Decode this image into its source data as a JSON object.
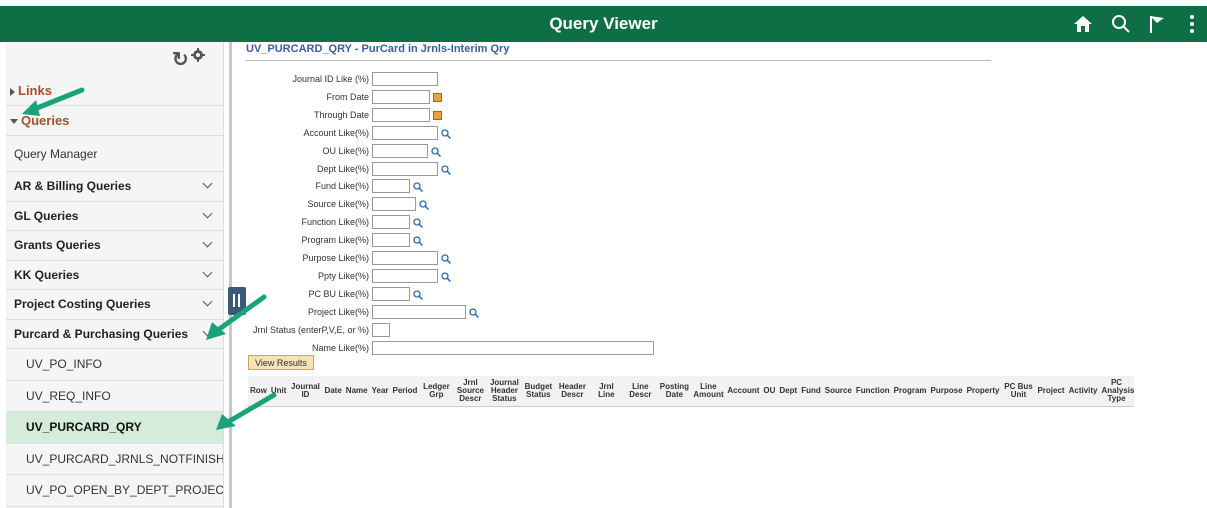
{
  "header": {
    "title": "Query Viewer"
  },
  "header_icons": [
    "home-icon",
    "search-icon",
    "flag-icon",
    "more-vert-icon"
  ],
  "sidebar": {
    "links_label": "Links",
    "queries_label": "Queries",
    "query_manager": "Query Manager",
    "groups": [
      "AR & Billing Queries",
      "GL Queries",
      "Grants Queries",
      "KK Queries",
      "Project Costing Queries",
      "Purcard & Purchasing Queries"
    ],
    "items": [
      "UV_PO_INFO",
      "UV_REQ_INFO",
      "UV_PURCARD_QRY",
      "UV_PURCARD_JRNLS_NOTFINISHED",
      "UV_PO_OPEN_BY_DEPT_PROJECT"
    ],
    "selected_item": "UV_PURCARD_QRY"
  },
  "query": {
    "title": "UV_PURCARD_QRY - PurCard in Jrnls-Interim Qry",
    "prompts": [
      {
        "label": "Journal ID Like (%)",
        "value": ""
      },
      {
        "label": "From Date",
        "value": ""
      },
      {
        "label": "Through Date",
        "value": ""
      },
      {
        "label": "Account Like(%)",
        "value": ""
      },
      {
        "label": "OU Like(%)",
        "value": ""
      },
      {
        "label": "Dept Like(%)",
        "value": ""
      },
      {
        "label": "Fund Like(%)",
        "value": ""
      },
      {
        "label": "Source Like(%)",
        "value": ""
      },
      {
        "label": "Function Like(%)",
        "value": ""
      },
      {
        "label": "Program Like(%)",
        "value": ""
      },
      {
        "label": "Purpose Like(%)",
        "value": ""
      },
      {
        "label": "Ppty Like(%)",
        "value": ""
      },
      {
        "label": "PC BU Like(%)",
        "value": ""
      },
      {
        "label": "Project Like(%)",
        "value": ""
      },
      {
        "label": "Jrnl Status (enterP,V,E, or %)",
        "value": ""
      },
      {
        "label": "Name Like(%)",
        "value": ""
      }
    ],
    "view_results": "View Results",
    "columns": [
      "Row",
      "Unit",
      "Journal ID",
      "Date",
      "Name",
      "Year",
      "Period",
      "Ledger Grp",
      "Jrnl Source Descr",
      "Journal Header Status",
      "Budget Status",
      "Header Descr",
      "Jrnl Line",
      "Line Descr",
      "Posting Date",
      "Line Amount",
      "Account",
      "OU",
      "Dept",
      "Fund",
      "Source",
      "Function",
      "Program",
      "Purpose",
      "Property",
      "PC Bus Unit",
      "Project",
      "Activity",
      "PC Analysis Type"
    ]
  },
  "colors": {
    "header_bg": "#0e6f47",
    "folder_text": "#a0522d",
    "selected_bg": "#d4ecd9",
    "arrow": "#1aa37a"
  }
}
